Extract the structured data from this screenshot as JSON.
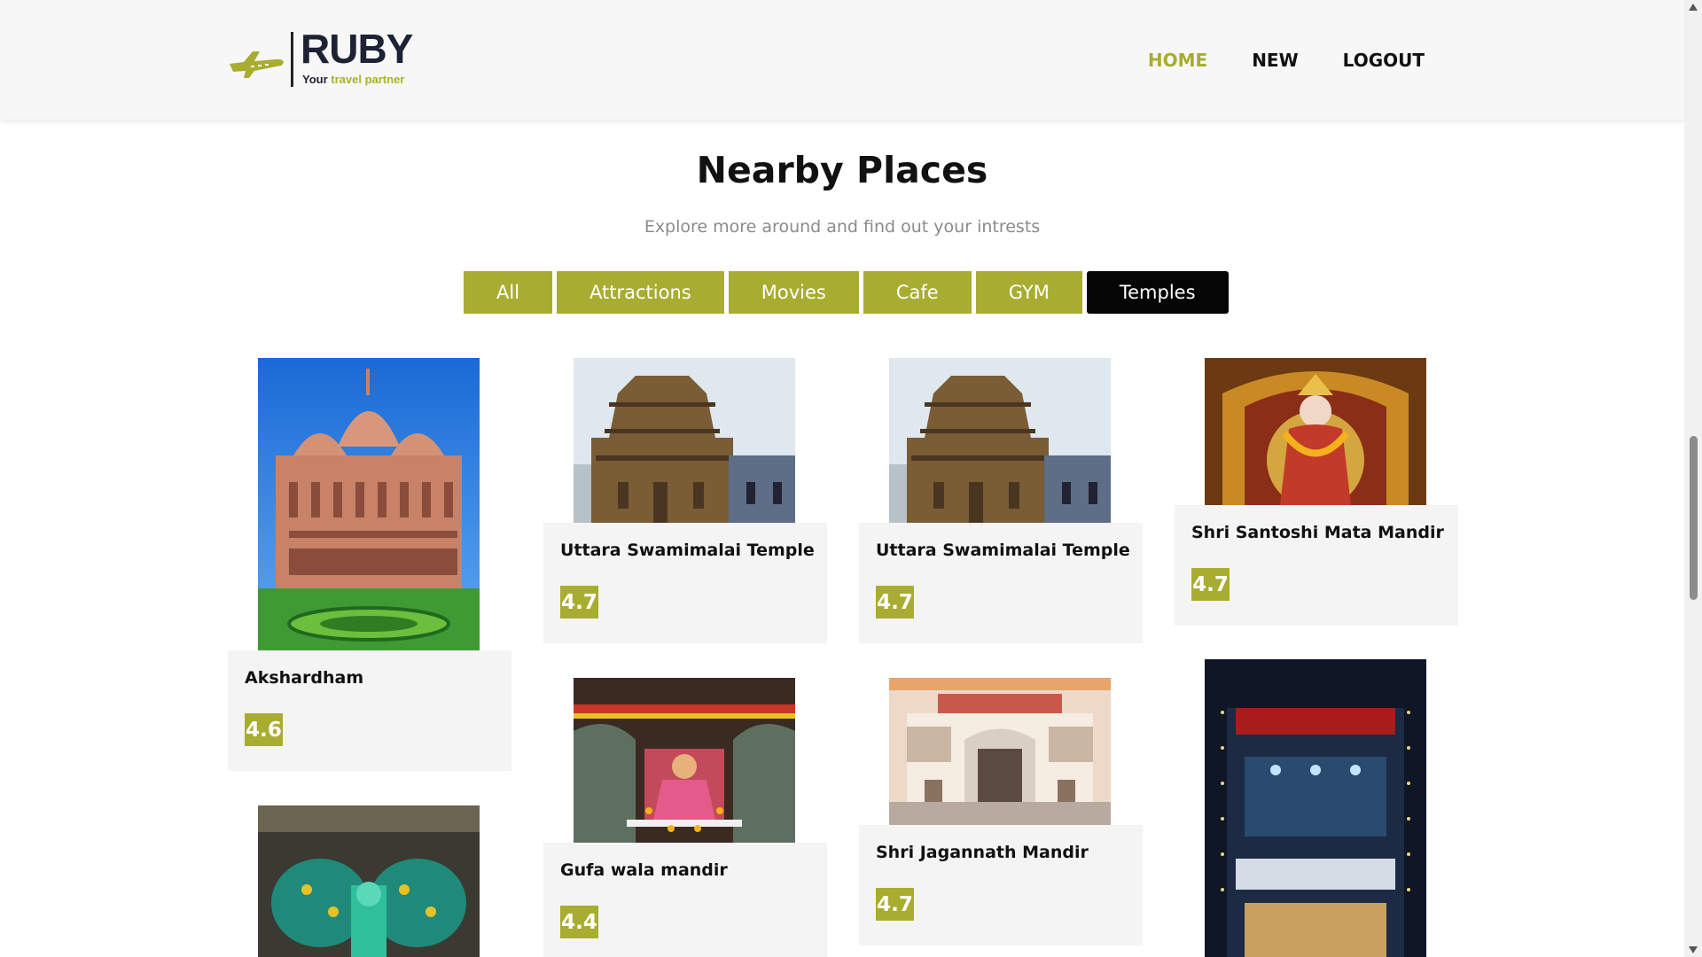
{
  "brand": {
    "name": "RUBY",
    "tagline_1": "Your ",
    "tagline_2": "travel partner",
    "accent": "#a8ad31",
    "dark": "#1e2235"
  },
  "nav": [
    {
      "label": "HOME",
      "active": true
    },
    {
      "label": "NEW",
      "active": false
    },
    {
      "label": "LOGOUT",
      "active": false
    }
  ],
  "section": {
    "title": "Nearby Places",
    "subtitle": "Explore more around and find out your intrests"
  },
  "filters": [
    {
      "label": "All",
      "active": false
    },
    {
      "label": "Attractions",
      "active": false
    },
    {
      "label": "Movies",
      "active": false
    },
    {
      "label": "Cafe",
      "active": false
    },
    {
      "label": "GYM",
      "active": false
    },
    {
      "label": "Temples",
      "active": true
    }
  ],
  "places": [
    {
      "name": "Akshardham",
      "rating": "4.6",
      "image": "pink-stone-temple-icon"
    },
    {
      "name": "Uttara Swamimalai Temple",
      "rating": "4.7",
      "image": "gopuram-temple-icon"
    },
    {
      "name": "Uttara Swamimalai Temple",
      "rating": "4.7",
      "image": "gopuram-temple-icon"
    },
    {
      "name": "Shri Santoshi Mata Mandir",
      "rating": "4.7",
      "image": "goddess-idol-icon"
    },
    {
      "name": "Gufa wala mandir",
      "rating": "4.4",
      "image": "cave-shrine-icon"
    },
    {
      "name": "Shri Jagannath Mandir",
      "rating": "4.7",
      "image": "temple-entrance-icon"
    },
    {
      "name": "",
      "rating": "",
      "image": "peacock-mural-icon"
    },
    {
      "name": "",
      "rating": "",
      "image": "lit-shop-front-icon"
    }
  ]
}
